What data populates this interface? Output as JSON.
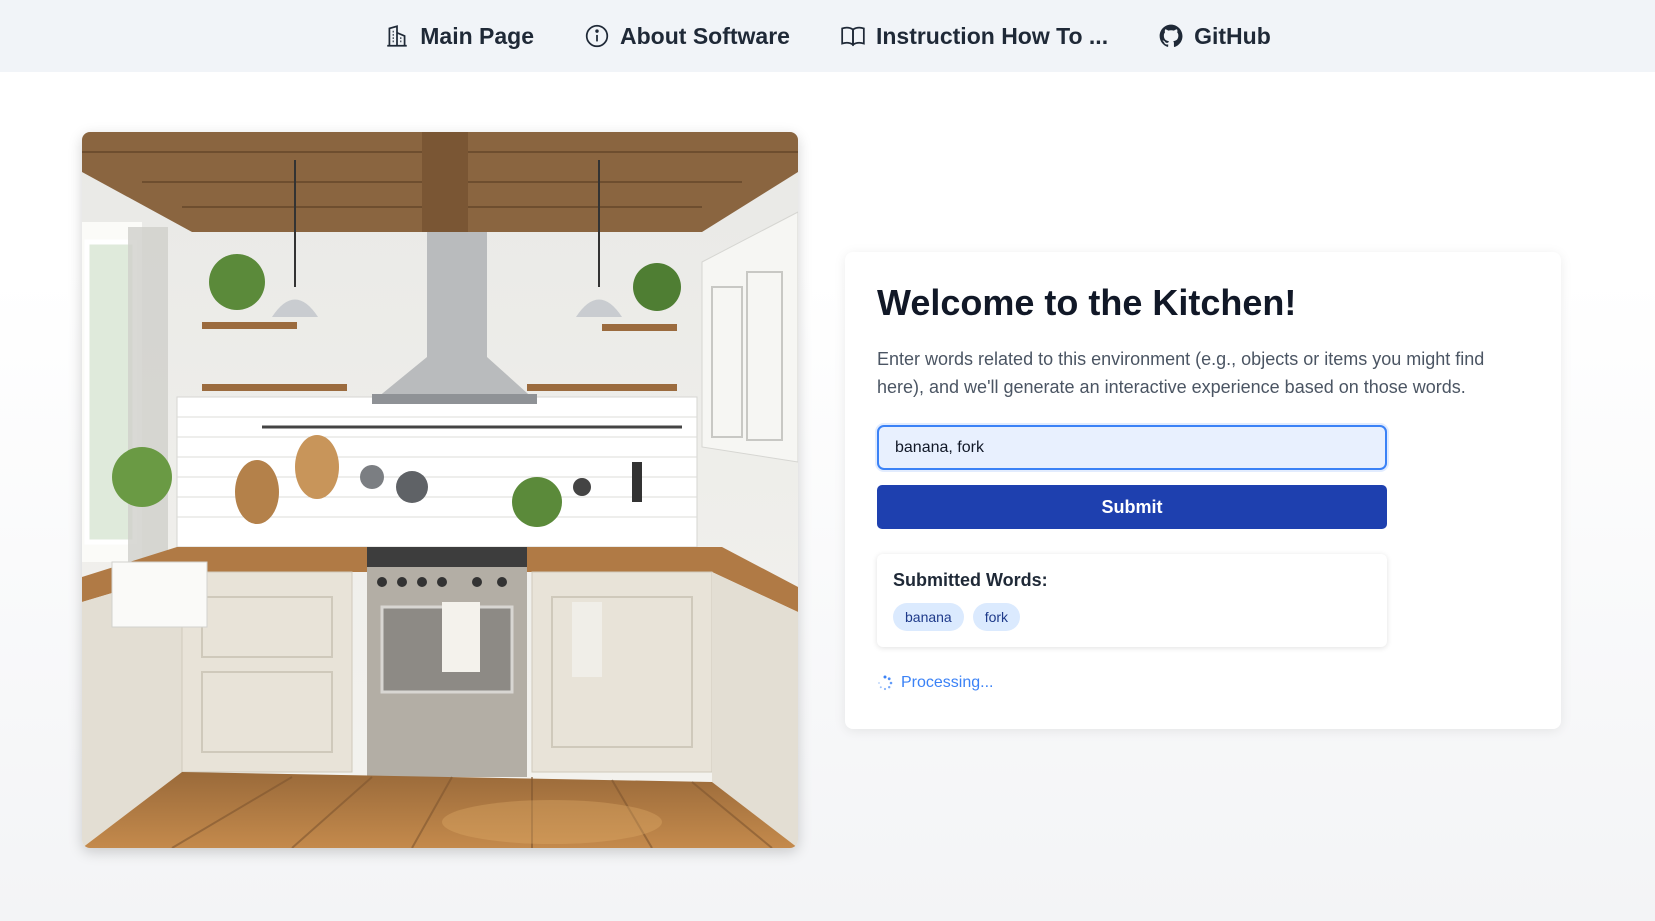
{
  "nav": {
    "items": [
      {
        "label": "Main Page",
        "icon": "building-icon"
      },
      {
        "label": "About Software",
        "icon": "info-icon"
      },
      {
        "label": "Instruction How To ...",
        "icon": "book-icon"
      },
      {
        "label": "GitHub",
        "icon": "github-icon"
      }
    ]
  },
  "hero": {
    "image_alt": "kitchen-illustration"
  },
  "card": {
    "title": "Welcome to the Kitchen!",
    "description": "Enter words related to this environment (e.g., objects or items you might find here), and we'll generate an interactive experience based on those words.",
    "input_value": "banana, fork",
    "submit_label": "Submit",
    "submitted_heading": "Submitted Words:",
    "submitted_words": [
      "banana",
      "fork"
    ],
    "status_text": "Processing..."
  },
  "colors": {
    "accent": "#1e40af",
    "nav_bg": "#f1f4f8",
    "tag_bg": "#dbeafe",
    "status": "#3b82f6"
  }
}
